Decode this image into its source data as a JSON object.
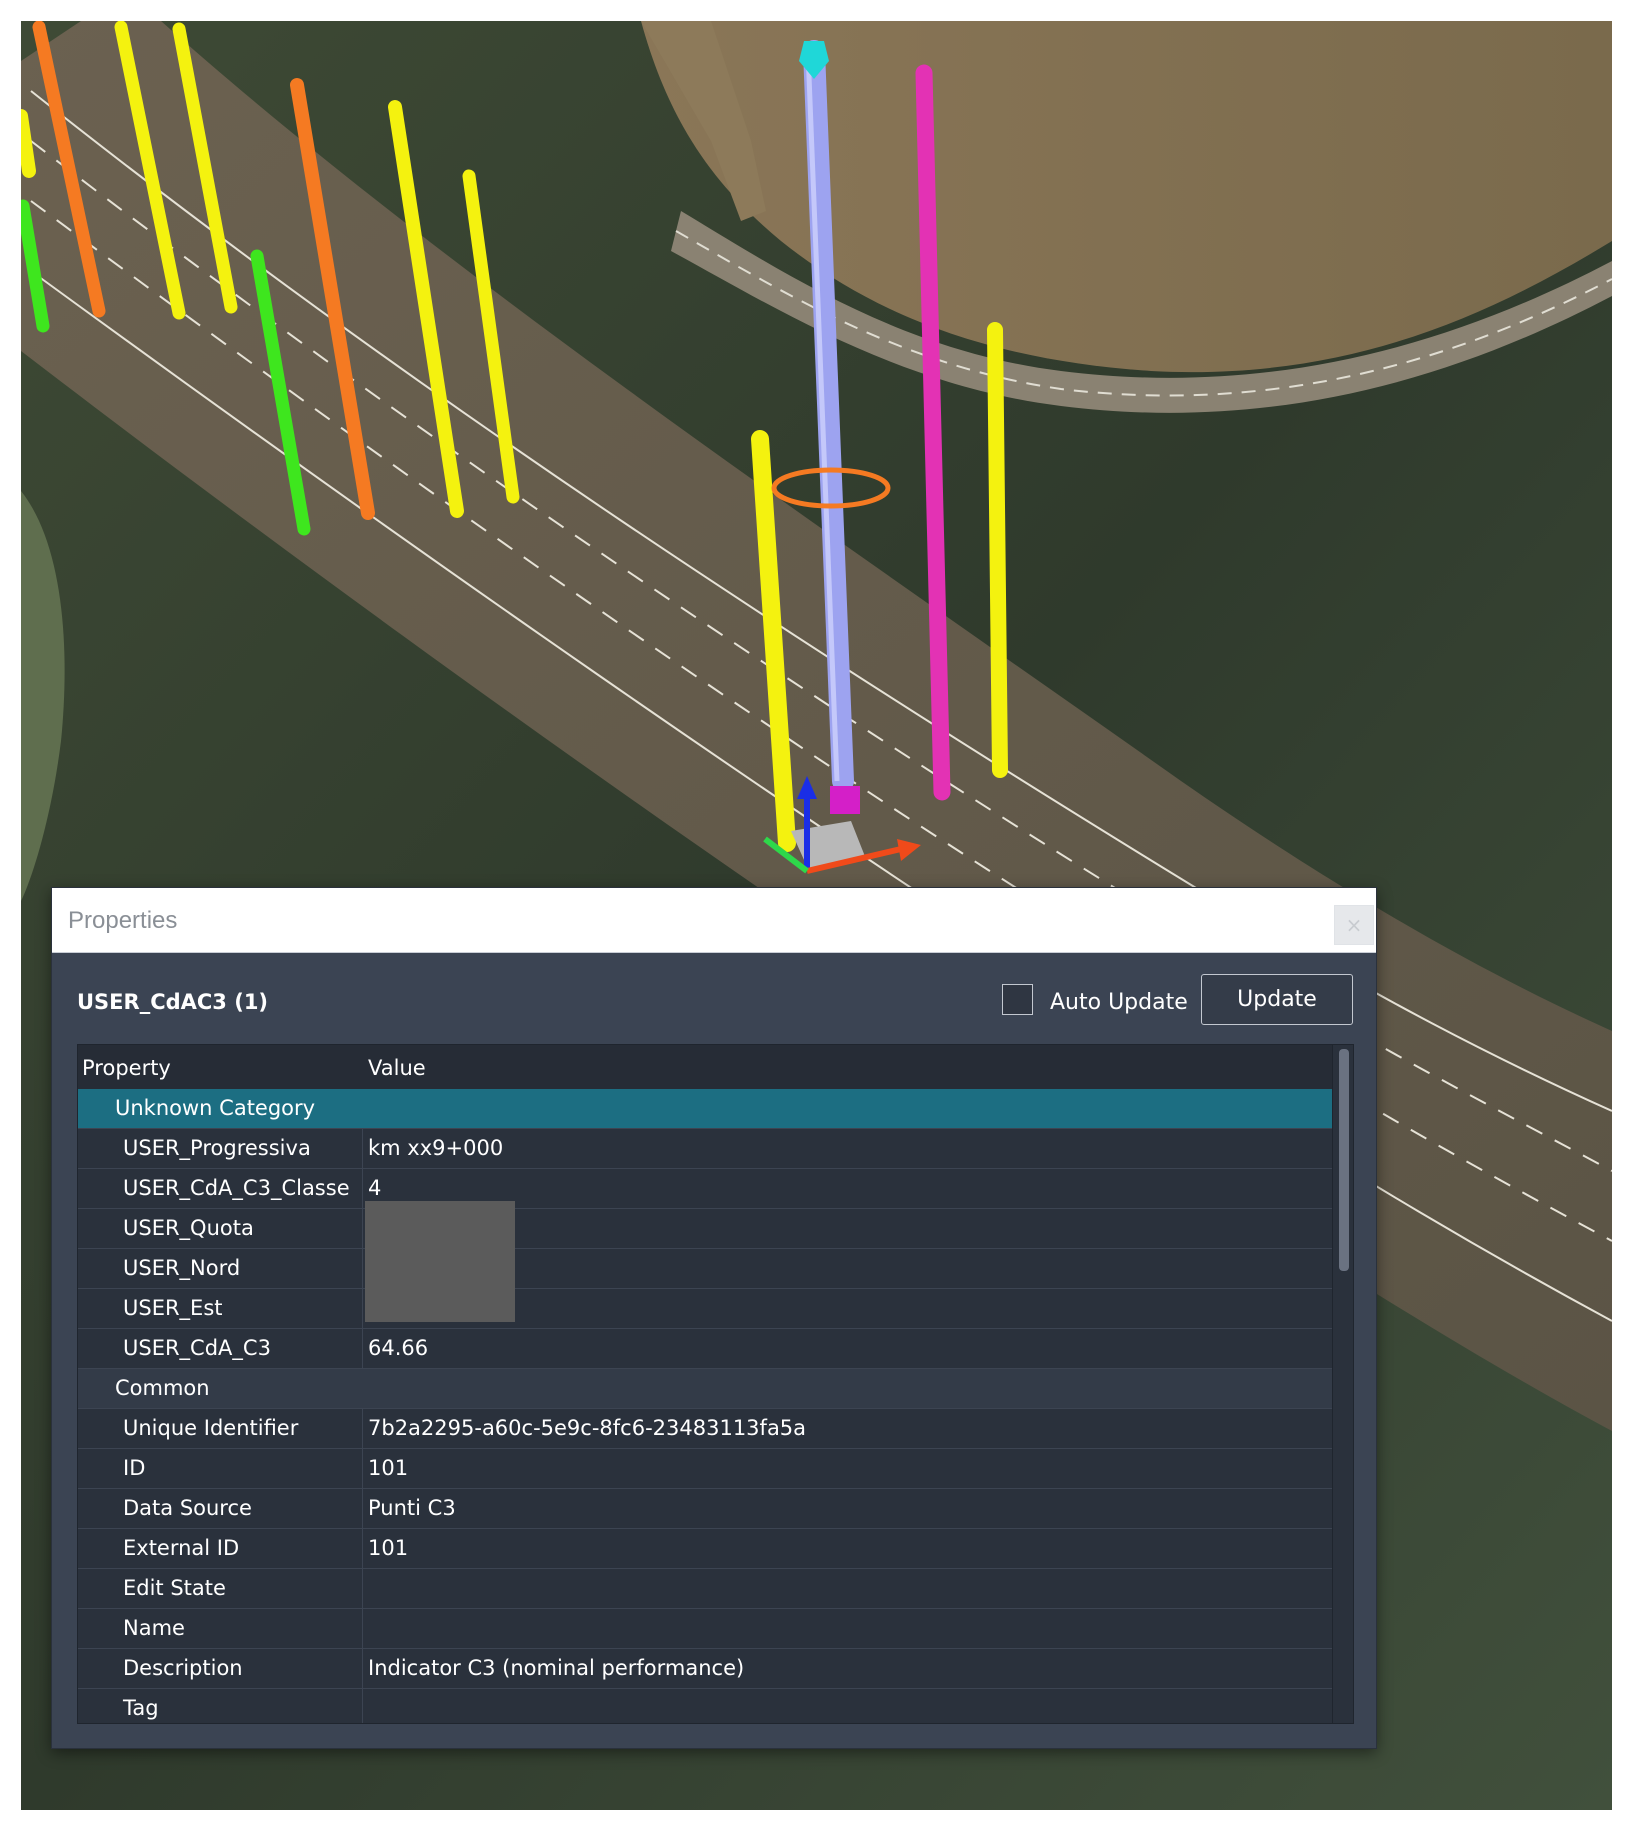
{
  "panel": {
    "title": "Properties",
    "close_label": "×",
    "object_title": "USER_CdAC3 (1)",
    "auto_update_label": "Auto Update",
    "auto_update_checked": false,
    "update_label": "Update"
  },
  "grid": {
    "col_property": "Property",
    "col_value": "Value",
    "categories": [
      {
        "name": "Unknown Category",
        "selected": true,
        "rows": [
          {
            "key": "USER_Progressiva",
            "value": "km xx9+000"
          },
          {
            "key": "USER_CdA_C3_Classe",
            "value": "4"
          },
          {
            "key": "USER_Quota",
            "value": ""
          },
          {
            "key": "USER_Nord",
            "value": ""
          },
          {
            "key": "USER_Est",
            "value": ""
          },
          {
            "key": "USER_CdA_C3",
            "value": "64.66"
          }
        ]
      },
      {
        "name": "Common",
        "selected": false,
        "rows": [
          {
            "key": "Unique Identifier",
            "value": "7b2a2295-a60c-5e9c-8fc6-23483113fa5a"
          },
          {
            "key": "ID",
            "value": "101"
          },
          {
            "key": "Data Source",
            "value": "Punti C3"
          },
          {
            "key": "External ID",
            "value": "101"
          },
          {
            "key": "Edit State",
            "value": ""
          },
          {
            "key": "Name",
            "value": ""
          },
          {
            "key": "Description",
            "value": "Indicator C3 (nominal performance)"
          },
          {
            "key": "Tag",
            "value": ""
          }
        ]
      }
    ]
  },
  "colors": {
    "panel_bg": "#3b4453",
    "selected_category": "#1c6e82",
    "pole_yellow": "#f4f20f",
    "pole_orange": "#f57a22",
    "pole_green": "#3ee61e",
    "pole_magenta": "#e332b4",
    "pole_selected": "#9da3f0"
  }
}
